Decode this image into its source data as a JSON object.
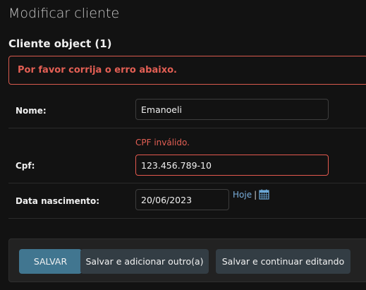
{
  "page": {
    "title": "Modificar cliente",
    "object_title": "Cliente object (1)"
  },
  "errornote": "Por favor corrija o erro abaixo.",
  "form": {
    "nome": {
      "label": "Nome:",
      "value": "Emanoeli"
    },
    "cpf": {
      "label": "Cpf:",
      "value": "123.456.789-10",
      "error": "CPF inválido."
    },
    "data_nascimento": {
      "label": "Data nascimento:",
      "value": "20/06/2023",
      "today_link": "Hoje",
      "separator": "|"
    }
  },
  "buttons": {
    "save": "SALVAR",
    "save_add": "Salvar e adicionar outro(a)",
    "save_continue": "Salvar e continuar editando"
  },
  "colors": {
    "background": "#121212",
    "error": "#e35f54",
    "primary_button": "#417690",
    "secondary_button": "#333d44",
    "link": "#79aedc"
  },
  "icons": {
    "calendar": "calendar-icon"
  }
}
